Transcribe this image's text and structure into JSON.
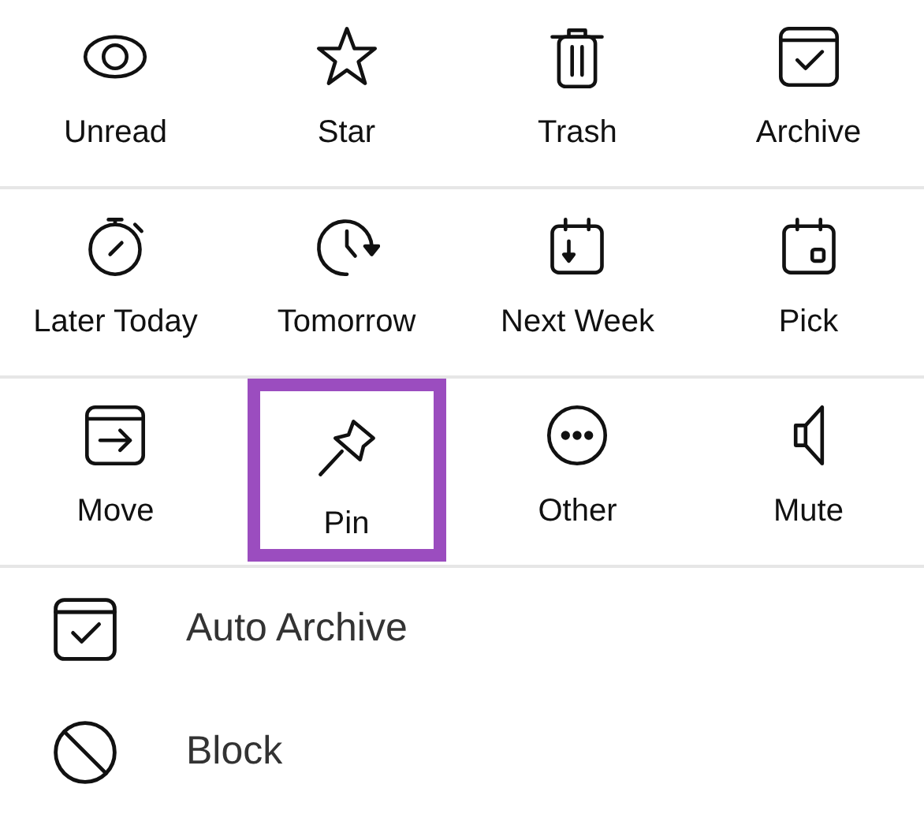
{
  "grid_rows": [
    [
      {
        "kind": "eye",
        "label": "Unread",
        "selected": false
      },
      {
        "kind": "star",
        "label": "Star",
        "selected": false
      },
      {
        "kind": "trash",
        "label": "Trash",
        "selected": false
      },
      {
        "kind": "archive",
        "label": "Archive",
        "selected": false
      }
    ],
    [
      {
        "kind": "timer",
        "label": "Later Today",
        "selected": false
      },
      {
        "kind": "clock",
        "label": "Tomorrow",
        "selected": false
      },
      {
        "kind": "week",
        "label": "Next Week",
        "selected": false
      },
      {
        "kind": "pick",
        "label": "Pick",
        "selected": false
      }
    ],
    [
      {
        "kind": "move",
        "label": "Move",
        "selected": false
      },
      {
        "kind": "pin",
        "label": "Pin",
        "selected": true
      },
      {
        "kind": "more",
        "label": "Other",
        "selected": false
      },
      {
        "kind": "speaker",
        "label": "Mute",
        "selected": false
      }
    ]
  ],
  "list_items": [
    {
      "kind": "archive",
      "label": "Auto Archive"
    },
    {
      "kind": "block",
      "label": "Block"
    }
  ]
}
